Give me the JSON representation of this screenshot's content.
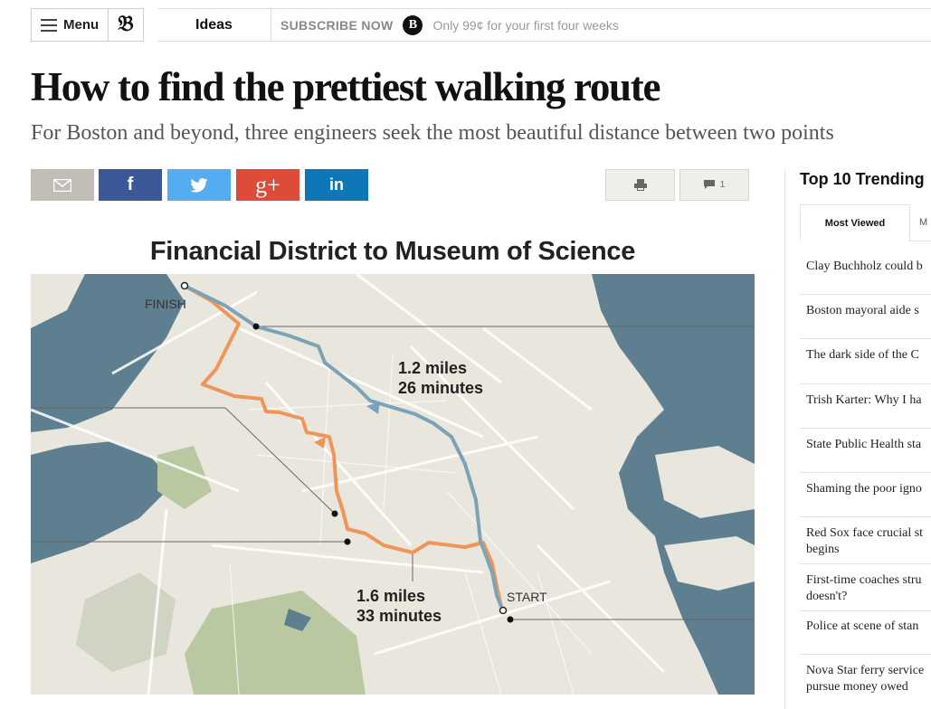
{
  "header": {
    "menu_label": "Menu",
    "logo_glyph": "𝔅",
    "section": "Ideas",
    "subscribe_label": "SUBSCRIBE NOW",
    "subscribe_logo": "B",
    "offer_text": "Only 99¢ for your first four weeks"
  },
  "article": {
    "headline": "How to find the prettiest walking route",
    "subhead": "For Boston and beyond, three engineers seek the most beautiful distance between two points"
  },
  "share": {
    "facebook_glyph": "f",
    "googleplus_glyph": "g+",
    "linkedin_glyph": "in",
    "comment_count": "1"
  },
  "graphic": {
    "title": "Financial District to Museum of Science",
    "finish_label": "FINISH",
    "start_label": "START",
    "blue_route_distance": "1.2 miles",
    "blue_route_time": "26 minutes",
    "orange_route_distance": "1.6 miles",
    "orange_route_time": "33 minutes",
    "blue_route_color": "#7aa3b8",
    "orange_route_color": "#f0955a",
    "water_color": "#5e7f8f",
    "park_color": "#b9c8a0"
  },
  "sidebar": {
    "title": "Top 10 Trending",
    "tab_active": "Most Viewed",
    "tab_next": "M",
    "items": [
      {
        "line1": "Clay Buchholz could b",
        "line2": ""
      },
      {
        "line1": "Boston mayoral aide s",
        "line2": ""
      },
      {
        "line1": "The dark side of the C",
        "line2": ""
      },
      {
        "line1": "Trish Karter: Why I ha",
        "line2": ""
      },
      {
        "line1": "State Public Health sta",
        "line2": ""
      },
      {
        "line1": "Shaming the poor igno",
        "line2": ""
      },
      {
        "line1": "Red Sox face crucial st",
        "line2": "begins"
      },
      {
        "line1": "First-time coaches stru",
        "line2": "doesn't?"
      },
      {
        "line1": "Police at scene of stan",
        "line2": ""
      },
      {
        "line1": "Nova Star ferry service",
        "line2": "pursue money owed"
      }
    ]
  }
}
